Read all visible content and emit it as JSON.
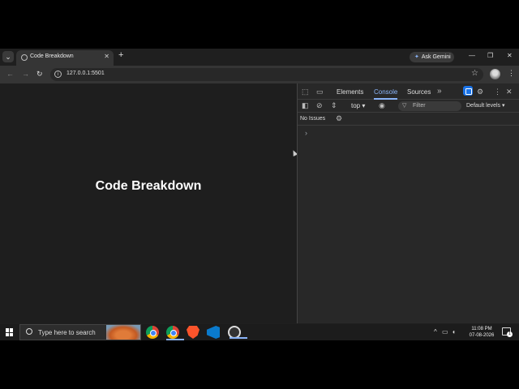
{
  "browser": {
    "tab_title": "Code Breakdown",
    "tab_close": "✕",
    "new_tab": "+",
    "ask_gemini": "Ask Gemini",
    "window_controls": {
      "minimize": "—",
      "restore": "❐",
      "close": "✕"
    },
    "url": "127.0.0.1:5501",
    "nav": {
      "back": "←",
      "forward": "→",
      "reload": "↻"
    }
  },
  "page": {
    "heading": "Code Breakdown"
  },
  "devtools": {
    "tabs": [
      "Elements",
      "Console",
      "Sources"
    ],
    "active_tab": "Console",
    "more": "»",
    "context_select": "top ▾",
    "filter_placeholder": "Filter",
    "levels": "Default levels ▾",
    "issues": "No Issues",
    "prompt": "›"
  },
  "taskbar": {
    "search_placeholder": "Type here to search",
    "time": "11:08 PM",
    "date": "07-08-2026",
    "notification_count": "1"
  },
  "colors": {
    "accent": "#8ab4f8",
    "page_bg": "#1e1e1e",
    "devtools_bg": "#282828"
  }
}
